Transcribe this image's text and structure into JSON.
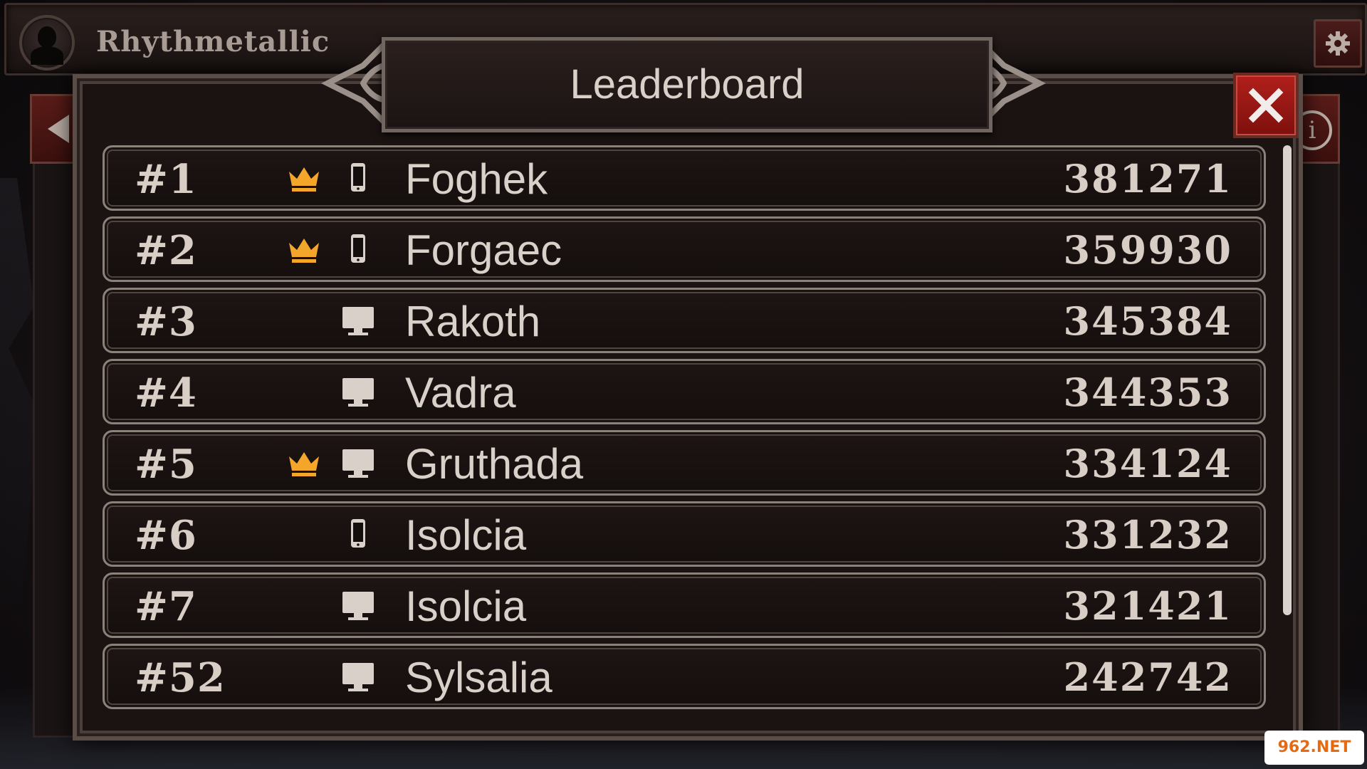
{
  "header": {
    "player_name": "Rhythmetallic"
  },
  "dialog": {
    "title": "Leaderboard"
  },
  "leaderboard": [
    {
      "rank": "#1",
      "crown": true,
      "device": "phone-icon",
      "name": "Foghek",
      "score": "381271"
    },
    {
      "rank": "#2",
      "crown": true,
      "device": "phone-icon",
      "name": "Forgaec",
      "score": "359930"
    },
    {
      "rank": "#3",
      "crown": false,
      "device": "desktop-icon",
      "name": "Rakoth",
      "score": "345384"
    },
    {
      "rank": "#4",
      "crown": false,
      "device": "desktop-icon",
      "name": "Vadra",
      "score": "344353"
    },
    {
      "rank": "#5",
      "crown": true,
      "device": "desktop-icon",
      "name": "Gruthada",
      "score": "334124"
    },
    {
      "rank": "#6",
      "crown": false,
      "device": "phone-icon",
      "name": "Isolcia",
      "score": "331232"
    },
    {
      "rank": "#7",
      "crown": false,
      "device": "desktop-icon",
      "name": "Isolcia",
      "score": "321421"
    },
    {
      "rank": "#52",
      "crown": false,
      "device": "desktop-icon",
      "name": "Sylsalia",
      "score": "242742"
    }
  ],
  "watermark": "962.NET",
  "colors": {
    "crown": "#f4a62a",
    "close_button": "#b11f1b",
    "text": "#d9d0c9"
  }
}
